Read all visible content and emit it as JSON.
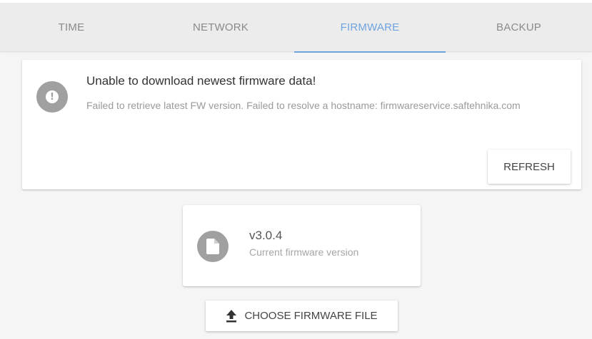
{
  "tabs": [
    {
      "label": "TIME",
      "active": false
    },
    {
      "label": "NETWORK",
      "active": false
    },
    {
      "label": "FIRMWARE",
      "active": true
    },
    {
      "label": "BACKUP",
      "active": false
    }
  ],
  "alert": {
    "icon": "exclamation-circle-icon",
    "title": "Unable to download newest firmware data!",
    "message": "Failed to retrieve latest FW version. Failed to resolve a hostname: firmwareservice.saftehnika.com",
    "refresh_label": "REFRESH"
  },
  "firmware": {
    "icon": "file-icon",
    "version": "v3.0.4",
    "caption": "Current firmware version"
  },
  "upload": {
    "icon": "upload-icon",
    "label": "CHOOSE FIRMWARE FILE"
  },
  "colors": {
    "accent": "#6fa3e0",
    "icon_circle": "#a0a0a0",
    "background": "#f5f5f5"
  }
}
